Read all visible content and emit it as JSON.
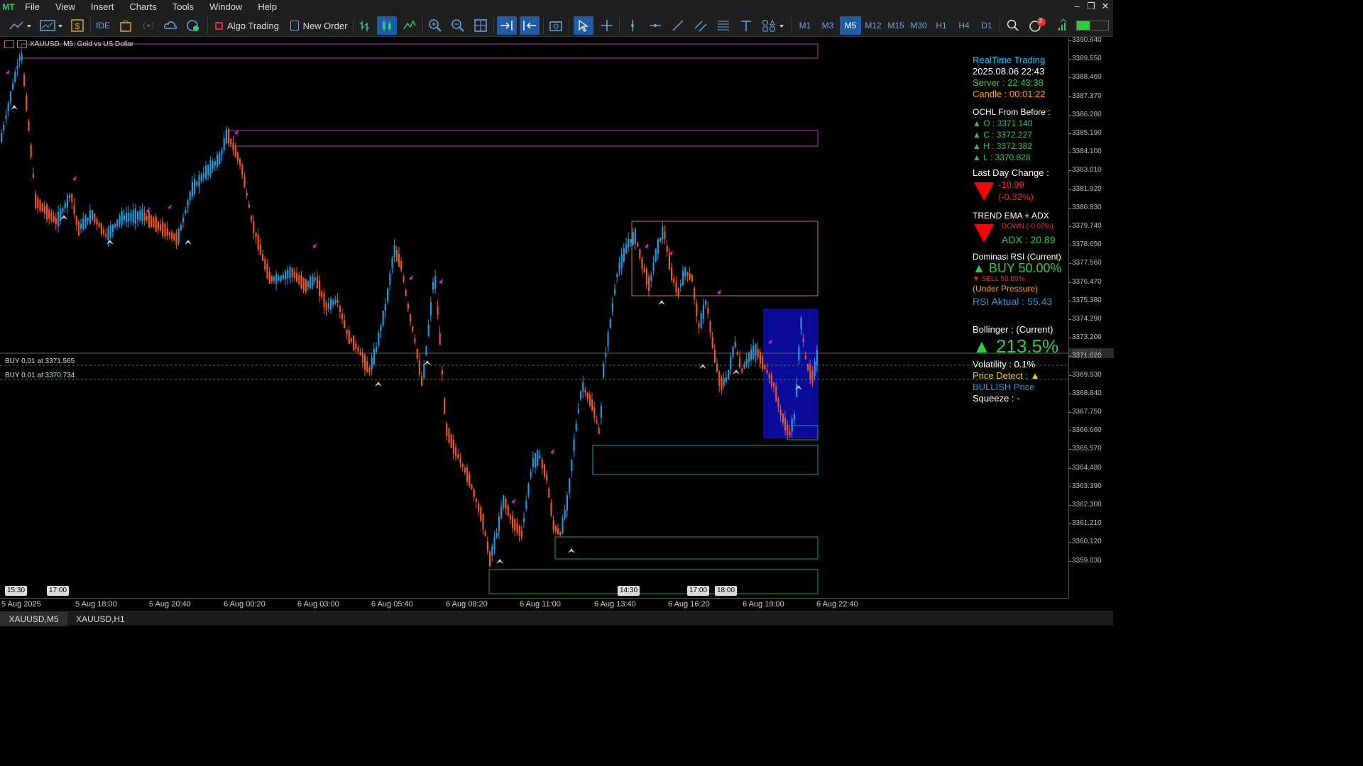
{
  "menu": [
    "File",
    "View",
    "Insert",
    "Charts",
    "Tools",
    "Window",
    "Help"
  ],
  "toolbar": {
    "algo_trading": "Algo Trading",
    "new_order": "New Order",
    "ide": "IDE",
    "timeframes": [
      "M1",
      "M3",
      "M5",
      "M12",
      "M15",
      "M30",
      "H1",
      "H4",
      "D1"
    ],
    "active_timeframe": "M5",
    "notification_count": "3"
  },
  "chart": {
    "title": "XAUUSD, M5:  Gold vs US Dollar",
    "orders": [
      "BUY 0.01 at 3371.565",
      "BUY 0.01 at 3370.734"
    ],
    "current_price": "3372.227",
    "price_ticks": [
      "3390.640",
      "3389.550",
      "3388.460",
      "3387.370",
      "3386.280",
      "3385.190",
      "3384.100",
      "3383.010",
      "3381.920",
      "3380.830",
      "3379.740",
      "3378.650",
      "3377.560",
      "3376.470",
      "3375.380",
      "3374.290",
      "3373.200",
      "3372.227",
      "3371.020",
      "3369.930",
      "3368.840",
      "3367.750",
      "3366.660",
      "3365.570",
      "3364.480",
      "3363.390",
      "3362.300",
      "3361.210",
      "3360.120",
      "3359.030"
    ],
    "time_ticks": [
      "5 Aug 2025",
      "5 Aug 18:00",
      "5 Aug 20:40",
      "6 Aug 00:20",
      "6 Aug 03:00",
      "6 Aug 05:40",
      "6 Aug 08:20",
      "6 Aug 11:00",
      "6 Aug 13:40",
      "6 Aug 16:20",
      "6 Aug 19:00",
      "6 Aug 22:40"
    ],
    "time_boxes": [
      "15:30",
      "17:00",
      "14:30",
      "17:00",
      "18:00"
    ],
    "colors": {
      "bull": "#1e9be0",
      "bear": "#f0561f",
      "zone_top": "#c040c0",
      "zone_orange": "#e08020",
      "zone_green": "#20a060",
      "highlight": "#0a0a9a"
    }
  },
  "info_panel": {
    "title": "RealTime Trading",
    "datetime": "2025.08.06 22:43",
    "server": "Server : 22:43:38",
    "candle": "Candle : 00:01:22",
    "ochl_title": "OCHL From Before :",
    "ochl": [
      "▲ O : 3371.140",
      "▲ C : 3372.227",
      "▲ H : 3372.382",
      "▲ L : 3370.828"
    ],
    "last_day_title": "Last Day Change :",
    "last_day_value": "-10.99",
    "last_day_pct": "(-0.32%)",
    "trend_title": "TREND EMA + ADX",
    "trend_dir": "DOWN (-0.02%)",
    "adx": "ADX : 20.89",
    "rsi_title": "Dominasi RSI (Current)",
    "rsi_buy": "▲ BUY 50.00%",
    "rsi_sell": "▼ SELL 50.00%",
    "rsi_pressure": "(Under Pressure)",
    "rsi_actual": "RSI Aktual : 55.43",
    "boll_title": "Bollinger : (Current)",
    "boll_value": "▲ 213.5%",
    "volatility": "Volatility : 0.1%",
    "price_detect": "Price Detect : ▲",
    "bullish": "BULLISH Price",
    "squeeze": "Squeeze : -"
  },
  "tabs": [
    "XAUUSD,M5",
    "XAUUSD,H1"
  ]
}
